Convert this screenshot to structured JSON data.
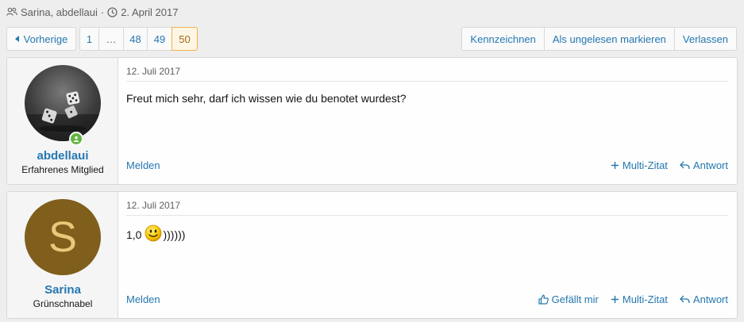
{
  "thread_meta": {
    "participants": "Sarina, abdellaui",
    "separator": "·",
    "date": "2. April 2017"
  },
  "pagination": {
    "prev_label": "Vorherige",
    "pages": [
      "1",
      "…",
      "48",
      "49",
      "50"
    ],
    "current_page": "50"
  },
  "thread_actions": {
    "mark": "Kennzeichnen",
    "mark_unread": "Als ungelesen markieren",
    "leave": "Verlassen"
  },
  "posts": [
    {
      "username": "abdellaui",
      "user_title": "Erfahrenes Mitglied",
      "avatar": "dice-photo",
      "online": true,
      "date": "12. Juli 2017",
      "text": "Freut mich sehr, darf ich wissen wie du benotet wurdest?",
      "report": "Melden",
      "multiquote": "Multi-Zitat",
      "reply": "Antwort"
    },
    {
      "username": "Sarina",
      "user_title": "Grünschnabel",
      "avatar_letter": "S",
      "avatar_color": "#7f5f1b",
      "date": "12. Juli 2017",
      "text_before": "1,0",
      "smiley": "smile-icon",
      "text_after": "))))))",
      "report": "Melden",
      "like": "Gefällt mir",
      "multiquote": "Multi-Zitat",
      "reply": "Antwort"
    }
  ],
  "colors": {
    "link": "#2577b1",
    "accent_current_page": "#f0b14c",
    "online": "#63b543"
  }
}
